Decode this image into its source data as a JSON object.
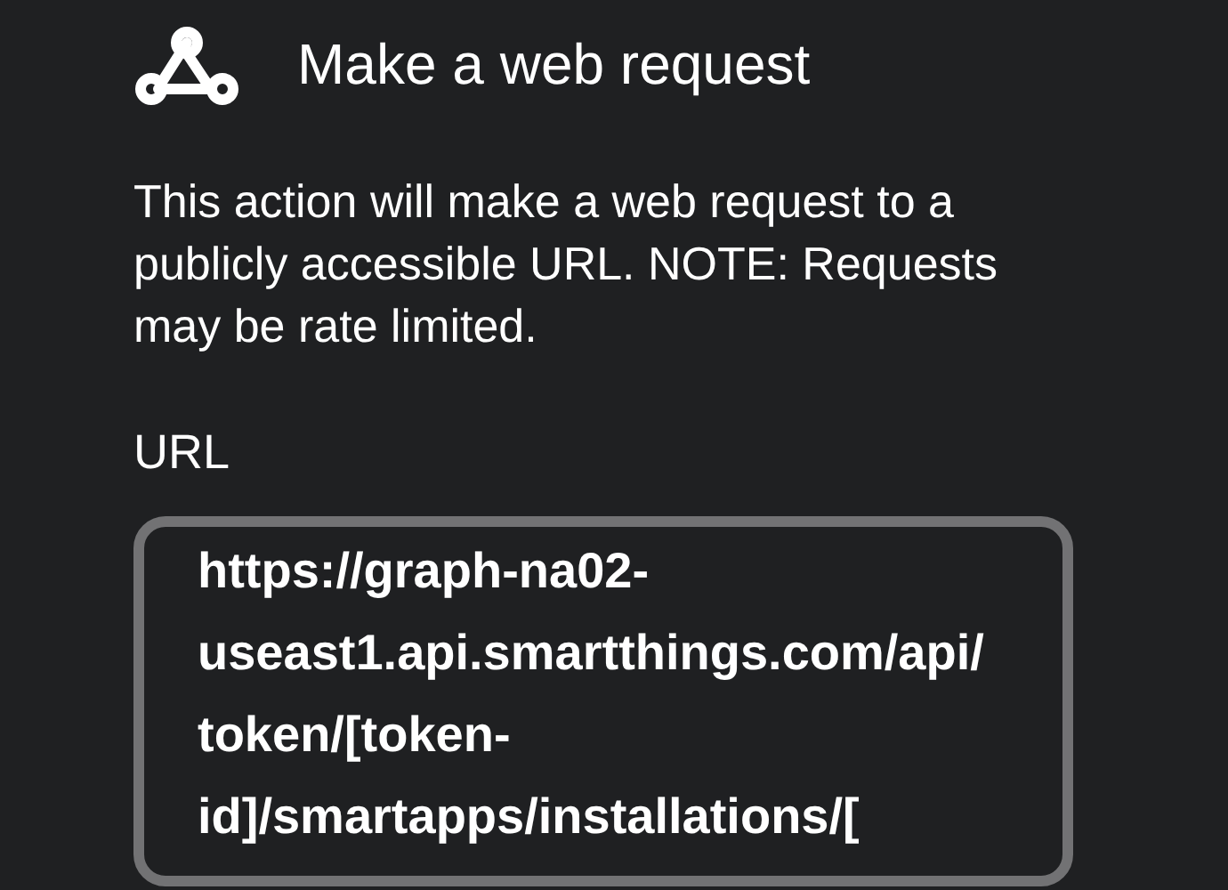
{
  "header": {
    "title": "Make a web request"
  },
  "description": "This action will make a web request to a publicly accessible URL. NOTE: Requests may be rate limited.",
  "url_field": {
    "label": "URL",
    "value": "https://graph-na02-useast1.api.smartthings.com/api/token/[token-id]/smartapps/installations/["
  }
}
